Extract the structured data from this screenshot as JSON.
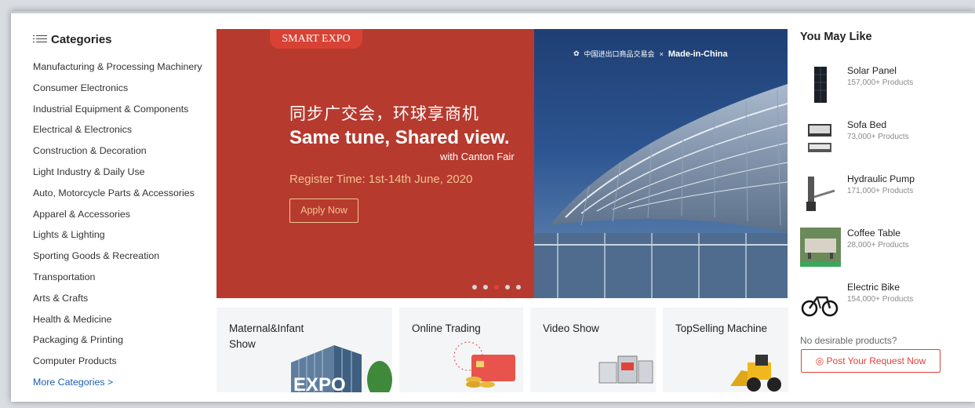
{
  "categories": {
    "title": "Categories",
    "items": [
      "Manufacturing & Processing Machinery",
      "Consumer Electronics",
      "Industrial Equipment & Components",
      "Electrical & Electronics",
      "Construction & Decoration",
      "Light Industry & Daily Use",
      "Auto, Motorcycle Parts & Accessories",
      "Apparel & Accessories",
      "Lights & Lighting",
      "Sporting Goods & Recreation",
      "Transportation",
      "Arts & Crafts",
      "Health & Medicine",
      "Packaging & Printing",
      "Computer Products"
    ],
    "more": "More Categories >"
  },
  "banner": {
    "tag": "SMART EXPO",
    "headline_cn": "同步广交会，环球享商机",
    "headline_en": "Same tune, Shared view.",
    "with": "with Canton Fair",
    "register": "Register Time: 1st-14th June, 2020",
    "apply": "Apply Now",
    "logo_left": "中国进出口商品交易会",
    "logo_right": "Made-in-China",
    "slide_count": 5,
    "active_slide": 2
  },
  "tiles": [
    {
      "label": "Maternal&Infant Show",
      "overlay": "EXPO"
    },
    {
      "label": "Online Trading"
    },
    {
      "label": "Video Show"
    },
    {
      "label": "TopSelling Machine"
    }
  ],
  "you_may_like": {
    "title": "You May Like",
    "products": [
      {
        "name": "Solar Panel",
        "count": "157,000+ Products"
      },
      {
        "name": "Sofa Bed",
        "count": "73,000+ Products"
      },
      {
        "name": "Hydraulic Pump",
        "count": "171,000+ Products"
      },
      {
        "name": "Coffee Table",
        "count": "28,000+ Products"
      },
      {
        "name": "Electric Bike",
        "count": "154,000+ Products"
      }
    ],
    "no_desirable": "No desirable products?",
    "post_request": "Post Your Request Now"
  },
  "colors": {
    "accent_red": "#e2423a",
    "banner_red": "#b73a2e",
    "link_blue": "#1a5fb4",
    "gold": "#f2c38f"
  }
}
